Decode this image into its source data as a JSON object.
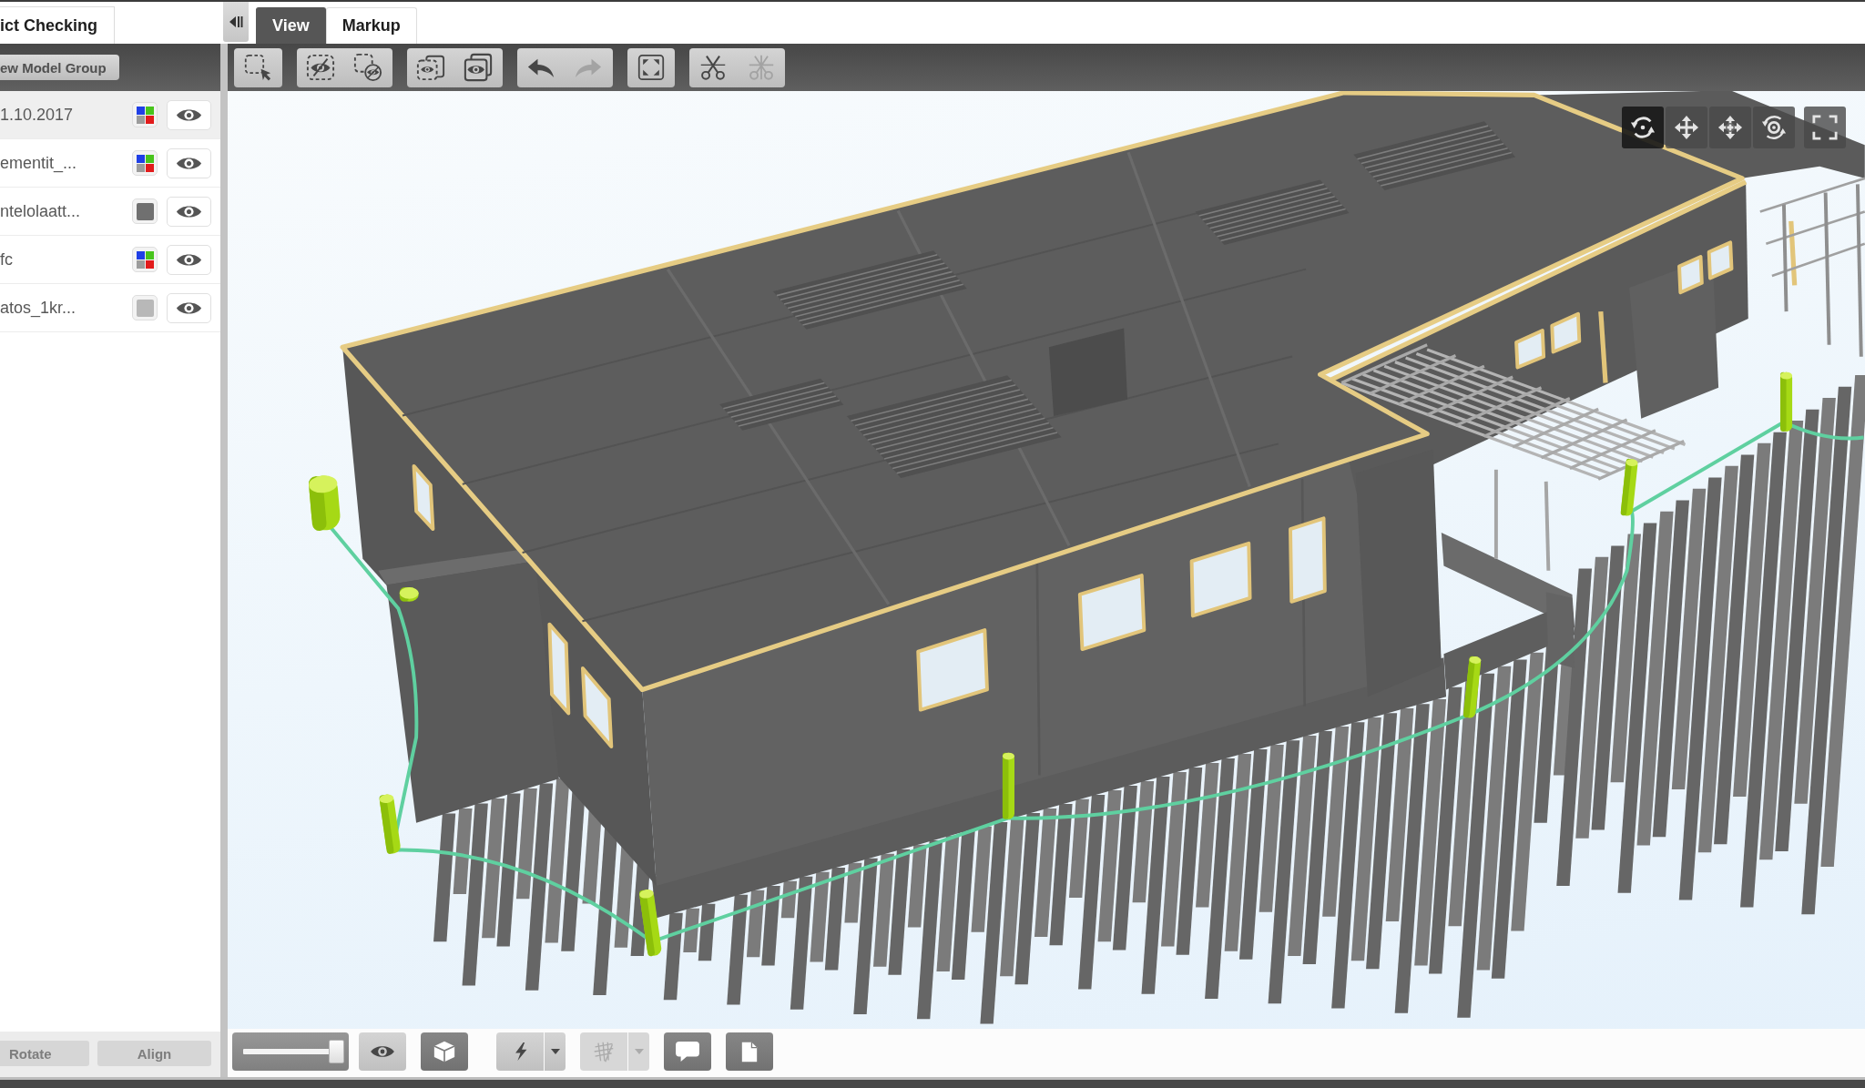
{
  "left_panel": {
    "tab": {
      "label": "ict Checking"
    },
    "new_group_button": {
      "label": "ew Model Group"
    },
    "models": [
      {
        "name": "1.10.2017",
        "selected": true,
        "swatch": {
          "kind": "multi"
        },
        "visible": true
      },
      {
        "name": "ementit_...",
        "selected": false,
        "swatch": {
          "kind": "multi"
        },
        "visible": true
      },
      {
        "name": "ntelolaatt...",
        "selected": false,
        "swatch": {
          "kind": "solid",
          "color": "#707070"
        },
        "visible": true
      },
      {
        "name": "fc",
        "selected": false,
        "swatch": {
          "kind": "multi"
        },
        "visible": true
      },
      {
        "name": "atos_1kr...",
        "selected": false,
        "swatch": {
          "kind": "solid",
          "color": "#b8b8b8"
        },
        "visible": true
      }
    ],
    "footer_buttons": [
      {
        "label": "Rotate",
        "disabled": true
      },
      {
        "label": "Align",
        "disabled": true
      }
    ]
  },
  "tabs": [
    {
      "label": "View",
      "selected": true
    },
    {
      "label": "Markup",
      "selected": false
    }
  ],
  "toolbar": {
    "groups": [
      [
        {
          "kind": "box-select",
          "disabled": false
        }
      ],
      [
        {
          "kind": "hide-selected",
          "disabled": false
        },
        {
          "kind": "hide-box",
          "disabled": false
        }
      ],
      [
        {
          "kind": "show-box",
          "disabled": false
        },
        {
          "kind": "show-all",
          "disabled": false
        }
      ],
      [
        {
          "kind": "undo",
          "disabled": false
        },
        {
          "kind": "redo",
          "disabled": true
        }
      ],
      [
        {
          "kind": "fit",
          "disabled": false
        }
      ],
      [
        {
          "kind": "section",
          "disabled": false
        },
        {
          "kind": "section-clear",
          "disabled": true
        }
      ]
    ]
  },
  "viewport": {
    "navigation_tools": [
      {
        "kind": "orbit",
        "selected": true
      },
      {
        "kind": "pan",
        "selected": false
      },
      {
        "kind": "pan-center",
        "selected": false
      },
      {
        "kind": "look-around",
        "selected": false
      },
      {
        "kind": "fullscreen",
        "selected": false
      }
    ]
  },
  "bottom_toolbar": {
    "slider": {
      "level": 1
    },
    "tool_groups": [
      [
        {
          "kind": "visibility",
          "on": false,
          "disabled": false,
          "dropdown": false
        },
        {
          "kind": "cube",
          "on": true,
          "disabled": false,
          "dropdown": false
        }
      ],
      [
        {
          "kind": "lightning",
          "on": false,
          "disabled": false,
          "dropdown": true
        },
        {
          "kind": "mesh",
          "on": false,
          "disabled": true,
          "dropdown": true
        },
        {
          "kind": "comment",
          "on": true,
          "disabled": false,
          "dropdown": false
        },
        {
          "kind": "document",
          "on": true,
          "disabled": false,
          "dropdown": false
        }
      ]
    ]
  }
}
